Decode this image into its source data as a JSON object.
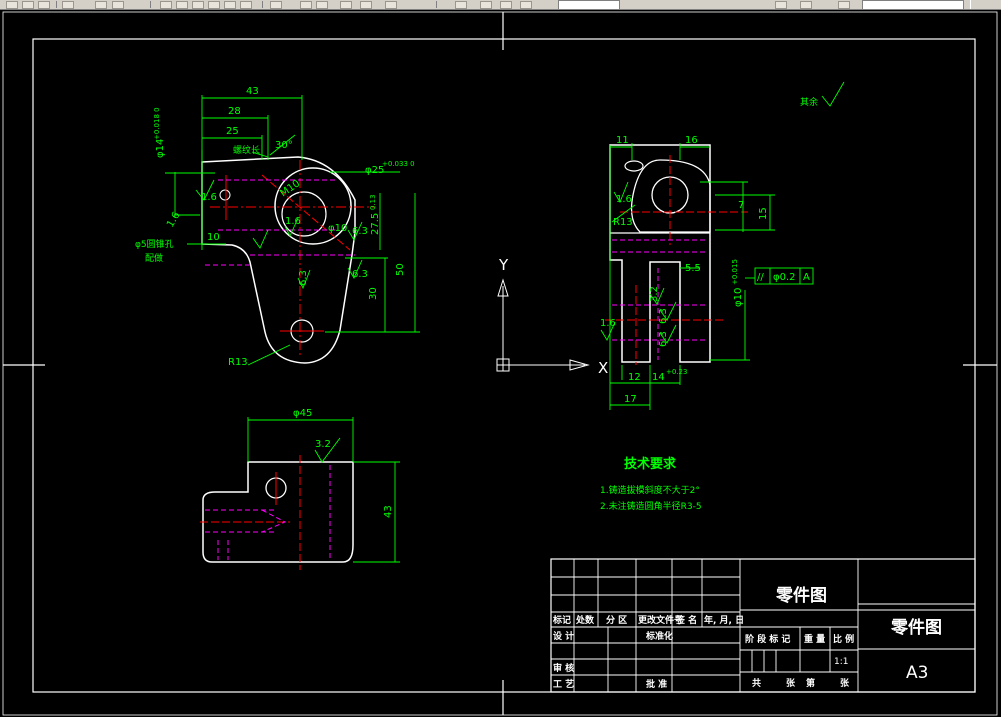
{
  "colors": {
    "background": "#000000",
    "outline": "#ffffff",
    "dimension": "#00ff00",
    "centerline": "#ff0000",
    "hidden": "#ff00ff",
    "tech": "#00ff00"
  },
  "front_view": {
    "dims": {
      "d43": "43",
      "d28": "28",
      "d25": "25",
      "d30deg": "30°",
      "d10": "10",
      "d50": "50",
      "d30": "30",
      "r13": "R13"
    },
    "phi25": "φ25",
    "phi25_tol": "+0.033\n0",
    "phi14": "φ14",
    "phi14_tol": "+0.018\n0",
    "m10": "M10",
    "m10_note": "螺纹长",
    "hole5": "φ5圆锥孔",
    "hole5_note": "配做",
    "phi10v": "φ10",
    "d27": "27.5",
    "d27_tol": "0.13",
    "rough": [
      "1.6",
      "1.6",
      "6.3",
      "6.3",
      "6.3",
      "1.6"
    ]
  },
  "side_view": {
    "dims": {
      "d11": "11",
      "d16": "16",
      "d7": "7",
      "d15": "15",
      "r13": "R13",
      "d55": "5.5",
      "d12": "12",
      "d14": "14",
      "d14_tol": "+0.23",
      "d17": "17",
      "d10": "φ10",
      "d10_tol": "+0.015"
    },
    "tolerance_frame": {
      "symbol": "//",
      "value": "φ0.2",
      "datum": "A"
    },
    "rough": [
      "1.6",
      "3.2",
      "6.3",
      "6.3",
      "1.6"
    ]
  },
  "top_view": {
    "dims": {
      "d45": "φ45",
      "d43": "43",
      "rough": "3.2"
    }
  },
  "surface_note": "其余",
  "axes": {
    "y": "Y",
    "x": "X"
  },
  "tech_requirements": {
    "title": "技术要求",
    "lines": [
      "1.铸造拔模斜度不大于2°",
      "2.未注铸造圆角半径R3-5"
    ]
  },
  "title_block": {
    "drawing_name": "零件图",
    "drawing_name_right": "零件图",
    "sheet_size": "A3",
    "scale": "1:1",
    "header": [
      "标记",
      "处数",
      "分 区",
      "更改文件号",
      "签 名",
      "年, 月, 日"
    ],
    "design": "设 计",
    "standard": "标准化",
    "stage_cols": [
      "阶 段 标 记",
      "重 量",
      "比 例"
    ],
    "review": "审 核",
    "craft": "工 艺",
    "approve": "批 准",
    "footer": [
      "共",
      "张",
      "第",
      "张"
    ]
  }
}
